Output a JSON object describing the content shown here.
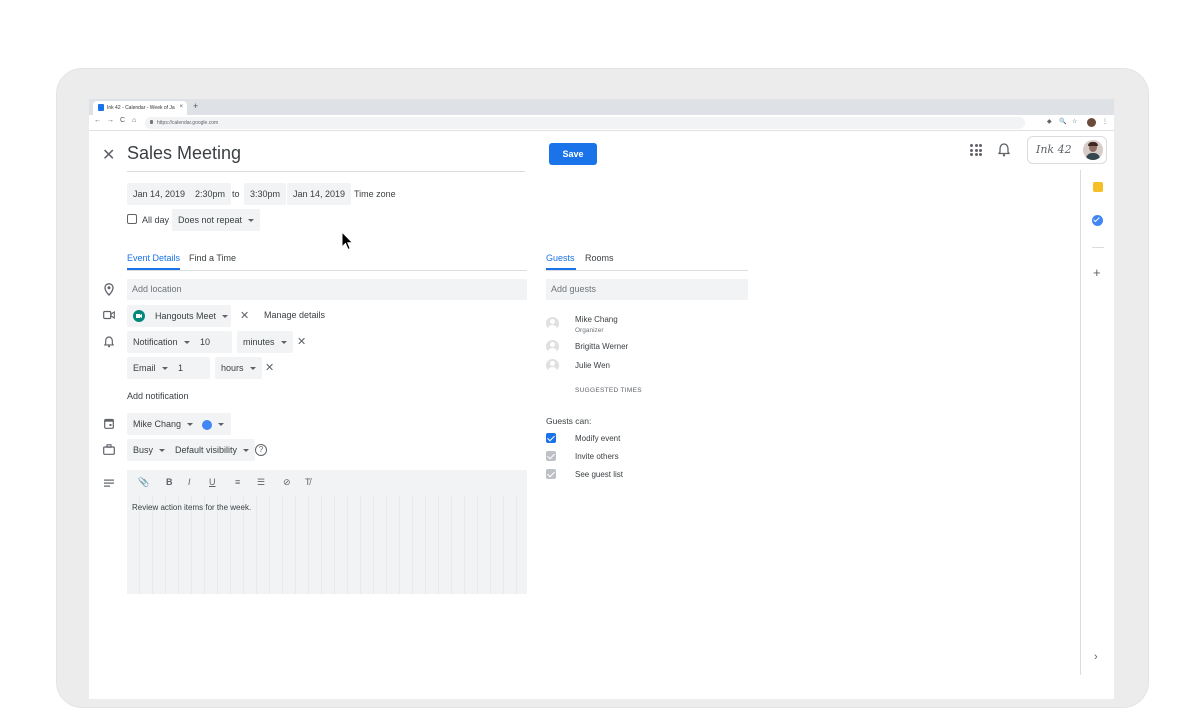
{
  "browser": {
    "tab_title": "Ink 42 - Calendar - Week of Ja",
    "tab_close": "×",
    "new_tab": "+",
    "url": "https://calendar.google.com",
    "nav": [
      "←",
      "→",
      "C",
      "⌂"
    ],
    "extensions": [
      "◆",
      "🔍",
      "☆",
      "⋮"
    ]
  },
  "header": {
    "close": "✕",
    "title": "Sales Meeting",
    "save_label": "Save",
    "brand": "Ink 42",
    "accent_color": "#1a73e8"
  },
  "datetime": {
    "start_date": "Jan 14, 2019",
    "start_time": "2:30pm",
    "to": "to",
    "end_time": "3:30pm",
    "end_date": "Jan 14, 2019",
    "timezone": "Time zone",
    "all_day": "All day",
    "repeat": "Does not repeat"
  },
  "tabs": {
    "left": [
      "Event Details",
      "Find a Time"
    ],
    "right": [
      "Guests",
      "Rooms"
    ]
  },
  "details": {
    "location_placeholder": "Add location",
    "conference": "Hangouts Meet",
    "manage_details": "Manage details",
    "notifications": [
      {
        "type": "Notification",
        "value": "10",
        "unit": "minutes"
      },
      {
        "type": "Email",
        "value": "1",
        "unit": "hours"
      }
    ],
    "add_notification": "Add notification",
    "calendar_owner": "Mike Chang",
    "calendar_color": "#4285f4",
    "availability": "Busy",
    "visibility": "Default visibility",
    "help": "?",
    "description": "Review action items for the week.",
    "toolbar": [
      "📎",
      "B",
      "I",
      "U",
      "≡",
      "☰",
      "⊘",
      "T̸"
    ]
  },
  "guests": {
    "placeholder": "Add guests",
    "list": [
      {
        "name": "Mike Chang",
        "role": "Organizer"
      },
      {
        "name": "Brigitta Werner",
        "role": ""
      },
      {
        "name": "Julie Wen",
        "role": ""
      }
    ],
    "suggested_times": "SUGGESTED TIMES",
    "permissions_label": "Guests can:",
    "permissions": [
      {
        "label": "Modify event",
        "checked": true
      },
      {
        "label": "Invite others",
        "checked": true
      },
      {
        "label": "See guest list",
        "checked": true
      }
    ]
  },
  "side_panel": {
    "add": "+",
    "expand": "›"
  }
}
